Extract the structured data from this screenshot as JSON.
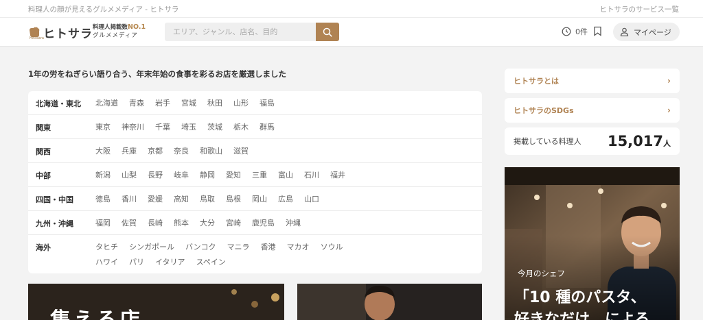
{
  "topbar": {
    "tagline": "料理人の顔が見えるグルメメディア - ヒトサラ",
    "services": "ヒトサラのサービス一覧"
  },
  "header": {
    "logo_text": "ヒトサラ",
    "logo_small": "Hitosara",
    "catch_line1": "料理人掲載数",
    "catch_no1": "NO.1",
    "catch_line2": "グルメメディア",
    "search_placeholder": "エリア、ジャンル、店名、目的",
    "history_count": "0件",
    "mypage_label": "マイページ"
  },
  "intro": "1年の労をねぎらい語り合う、年末年始の食事を彩るお店を厳選しました",
  "areas": [
    {
      "region": "北海道・東北",
      "prefs": [
        "北海道",
        "青森",
        "岩手",
        "宮城",
        "秋田",
        "山形",
        "福島"
      ]
    },
    {
      "region": "関東",
      "prefs": [
        "東京",
        "神奈川",
        "千葉",
        "埼玉",
        "茨城",
        "栃木",
        "群馬"
      ]
    },
    {
      "region": "関西",
      "prefs": [
        "大阪",
        "兵庫",
        "京都",
        "奈良",
        "和歌山",
        "滋賀"
      ]
    },
    {
      "region": "中部",
      "prefs": [
        "新潟",
        "山梨",
        "長野",
        "岐阜",
        "静岡",
        "愛知",
        "三重",
        "富山",
        "石川",
        "福井"
      ]
    },
    {
      "region": "四国・中国",
      "prefs": [
        "徳島",
        "香川",
        "愛媛",
        "高知",
        "鳥取",
        "島根",
        "岡山",
        "広島",
        "山口"
      ]
    },
    {
      "region": "九州・沖縄",
      "prefs": [
        "福岡",
        "佐賀",
        "長崎",
        "熊本",
        "大分",
        "宮崎",
        "鹿児島",
        "沖縄"
      ]
    },
    {
      "region": "海外",
      "prefs": [
        "タヒチ",
        "シンガポール",
        "バンコク",
        "マニラ",
        "香港",
        "マカオ",
        "ソウル",
        "ハワイ",
        "パリ",
        "イタリア",
        "スペイン"
      ]
    }
  ],
  "sidebar": {
    "about": "ヒトサラとは",
    "sdgs": "ヒトサラのSDGs",
    "count_label": "掲載している料理人",
    "count_value": "15,017",
    "count_unit": "人"
  },
  "chef_feature": {
    "kicker": "今月のシェフ",
    "quote_line1": "「10 種のパスタ、",
    "quote_line2": "好きなだけ　による"
  },
  "cards": {
    "card1_title": "集える店"
  },
  "colors": {
    "accent": "#b08353",
    "background": "#f3f3f3"
  }
}
